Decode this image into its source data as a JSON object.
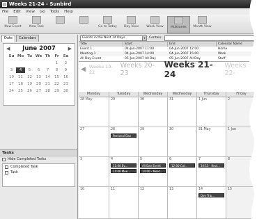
{
  "window": {
    "title": "Weeks 21-24 - Sunbird"
  },
  "menu": [
    "File",
    "Edit",
    "View",
    "Go",
    "Tools",
    "Help"
  ],
  "toolbar": [
    {
      "label": "New Event",
      "icon": "new-event-icon"
    },
    {
      "label": "New Task",
      "icon": "new-task-icon"
    },
    {
      "label": "",
      "icon": "edit-icon"
    },
    {
      "label": "",
      "icon": "delete-icon"
    },
    {
      "label": "Go to Today",
      "icon": "today-icon"
    },
    {
      "label": "Day View",
      "icon": "day-view-icon"
    },
    {
      "label": "Week View",
      "icon": "week-view-icon"
    },
    {
      "label": "Multiweek",
      "icon": "multiweek-icon",
      "active": true
    },
    {
      "label": "Month View",
      "icon": "month-view-icon"
    }
  ],
  "left": {
    "tabs": [
      "Date",
      "Calendars"
    ],
    "mini_calendar": {
      "month": "June 2007",
      "prev": "◀",
      "next": "▶",
      "dow": [
        "Su",
        "Mo",
        "Tu",
        "We",
        "Th",
        "Fr",
        "Sa"
      ],
      "days": [
        "",
        "",
        "",
        "",
        "",
        "1",
        "2",
        "3",
        "4",
        "5",
        "6",
        "7",
        "8",
        "9",
        "10",
        "11",
        "12",
        "13",
        "14",
        "15",
        "16",
        "17",
        "18",
        "19",
        "20",
        "21",
        "22",
        "23",
        "24",
        "25",
        "26",
        "27",
        "28",
        "29",
        "30"
      ],
      "selected": "4"
    },
    "tasks": {
      "title": "Tasks",
      "hide_completed": "Hide Completed Tasks",
      "items": [
        "Completed Task",
        "Task"
      ]
    }
  },
  "main": {
    "filter": {
      "value": "Events in the Next 14 Days",
      "label": "Contain:"
    },
    "list": {
      "columns": [
        "Title",
        "Start",
        "End",
        "Calendar Name"
      ],
      "rows": [
        [
          "Event 1",
          "04-Jun-2007 11:00",
          "04-Jun-2007 12:00",
          "Home"
        ],
        [
          "Meeting 1",
          "04-Jun-2007 14:00",
          "04-Jun-2007 15:00",
          "Work"
        ],
        [
          "All Day Event",
          "05-Jun-2007 All Day",
          "05-Jun-2007 All Day",
          "Stuff"
        ]
      ]
    },
    "week_nav": {
      "prev_arrow": "◀",
      "prev_week": "Weeks 19-22",
      "mid_week": "Weeks 20-23",
      "current": "Weeks 21-24",
      "next_week": "Weeks 22-"
    },
    "grid": {
      "days": [
        "Monday",
        "Tuesday",
        "Wednesday",
        "Wednesday",
        "Thursday",
        "Friday"
      ],
      "weeks": [
        [
          "28 May",
          "29",
          "30",
          "31",
          "1 Jun",
          "2"
        ],
        [
          "27",
          "28",
          "29",
          "30",
          "31 May",
          "1 Jun"
        ],
        [
          "3",
          "4",
          "5",
          "6",
          "7",
          "8"
        ],
        [
          "10",
          "11",
          "12",
          "13",
          "14",
          "15"
        ]
      ],
      "events": [
        {
          "week": 1,
          "day": 1,
          "slot": 0,
          "text": "Personal Day"
        },
        {
          "week": 2,
          "day": 1,
          "slot": 0,
          "text": "11:00 Ev..."
        },
        {
          "week": 2,
          "day": 1,
          "slot": 1,
          "text": "14:00 Mee..."
        },
        {
          "week": 2,
          "day": 2,
          "slot": 0,
          "text": "All Day Event"
        },
        {
          "week": 2,
          "day": 2,
          "slot": 1,
          "text": "14:00 - Meet..."
        },
        {
          "week": 2,
          "day": 3,
          "slot": 0,
          "text": "12:00 Cal..."
        },
        {
          "week": 2,
          "day": 4,
          "slot": 0,
          "text": "10:15 - Revi..."
        },
        {
          "week": 3,
          "day": 4,
          "slot": 0,
          "text": "Day Trip..."
        }
      ]
    }
  }
}
